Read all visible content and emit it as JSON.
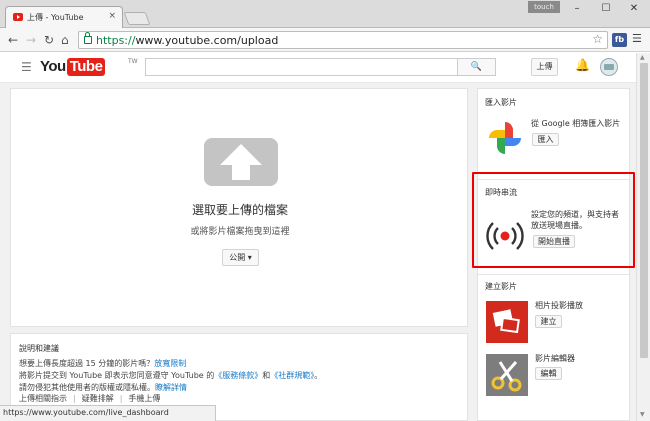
{
  "browser": {
    "tab_title": "上傳 - YouTube",
    "tab_close": "×",
    "user_badge": "touch",
    "minimize": "–",
    "maximize": "☐",
    "close": "✕",
    "url_protocol": "https://",
    "url_rest": "www.youtube.com/upload",
    "status_url": "https://www.youtube.com/live_dashboard"
  },
  "header": {
    "logo_you": "You",
    "logo_tube": "Tube",
    "logo_region": "TW",
    "search_placeholder": "",
    "upload_label": "上傳"
  },
  "upload": {
    "title": "選取要上傳的檔案",
    "subtitle": "或將影片檔案拖曳到這裡",
    "privacy_label": "公開 ▾"
  },
  "help": {
    "title": "說明和建議",
    "line1_text": "想要上傳長度超過 15 分鐘的影片嗎？",
    "line1_link": "放寬限制",
    "line2_a": "將影片提交到 YouTube 即表示您同意遵守 YouTube 的",
    "line2_link1": "《服務條款》",
    "line2_b": "和",
    "line2_link2": "《社群規範》",
    "line2_c": "。",
    "line3_text": "請勿侵犯其他使用者的版權或隱私權。",
    "line3_link": "瞭解詳情",
    "links": [
      "上傳相關指示",
      "疑難排解",
      "手機上傳"
    ]
  },
  "sidebar": {
    "import": {
      "title": "匯入影片",
      "desc": "從 Google 相簿匯入影片",
      "button": "匯入"
    },
    "live": {
      "title": "即時串流",
      "desc": "設定您的頻道，與支持者放送現場直播。",
      "button": "開始直播"
    },
    "create": {
      "title": "建立影片",
      "slideshow_label": "相片投影播放",
      "slideshow_button": "建立",
      "editor_label": "影片編輯器",
      "editor_button": "編輯"
    }
  },
  "colors": {
    "brand_red": "#e62117",
    "link_blue": "#167ac6",
    "highlight_red": "#e00000",
    "secure_green": "#0b8043"
  }
}
